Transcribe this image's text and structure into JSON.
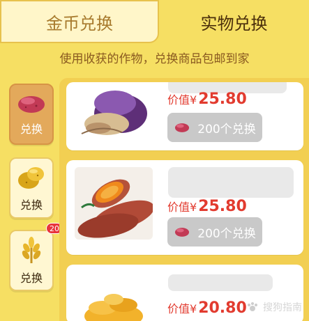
{
  "tabs": {
    "left": "金币兑换",
    "right": "实物兑换"
  },
  "subtitle": "使用收获的作物，兑换商品包邮到家",
  "sidebar": {
    "items": [
      {
        "label": "兑换",
        "icon": "sweet-potato-icon",
        "active": true
      },
      {
        "label": "兑换",
        "icon": "potato-icon",
        "active": false
      },
      {
        "label": "兑换",
        "icon": "wheat-icon",
        "active": false,
        "badge": "20"
      }
    ]
  },
  "products": [
    {
      "value_prefix": "价值¥",
      "value": "25.80",
      "button_label": "200个兑换"
    },
    {
      "value_prefix": "价值¥",
      "value": "25.80",
      "button_label": "200个兑换"
    },
    {
      "value_prefix": "价值¥",
      "value": "20.80"
    }
  ],
  "watermark": "搜狗指南",
  "colors": {
    "background": "#f6df63",
    "active_sidebar": "#e3a95b",
    "price": "#e23b2f",
    "button": "#c9c9c9"
  }
}
